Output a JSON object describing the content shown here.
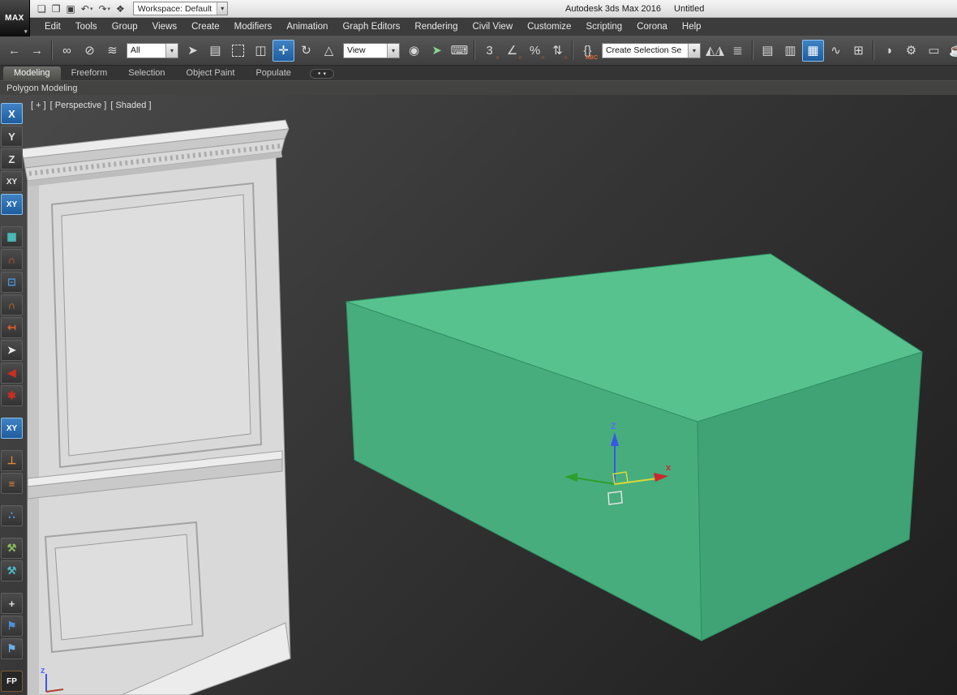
{
  "titlebar": {
    "app_button_label": "MAX",
    "quick_icons": [
      {
        "name": "new-scene-icon",
        "glyph": "❏"
      },
      {
        "name": "open-file-icon",
        "glyph": "❒"
      },
      {
        "name": "save-file-icon",
        "glyph": "▣"
      },
      {
        "name": "undo-icon",
        "glyph": "↶",
        "caret": true
      },
      {
        "name": "redo-icon",
        "glyph": "↷",
        "caret": true
      },
      {
        "name": "manage-workspace-icon",
        "glyph": "❖"
      }
    ],
    "workspace_value": "Workspace: Default",
    "window_title": "Autodesk 3ds Max 2016",
    "document_name": "Untitled"
  },
  "menubar": {
    "items": [
      "Edit",
      "Tools",
      "Group",
      "Views",
      "Create",
      "Modifiers",
      "Animation",
      "Graph Editors",
      "Rendering",
      "Civil View",
      "Customize",
      "Scripting",
      "Corona",
      "Help"
    ]
  },
  "toolbar": {
    "items": [
      {
        "name": "undo-button",
        "glyph": "←"
      },
      {
        "name": "redo-button",
        "glyph": "→"
      },
      {
        "name": "toolbar-separator",
        "sep": true
      },
      {
        "name": "select-and-link-button",
        "glyph": "∞"
      },
      {
        "name": "unlink-selection-button",
        "glyph": "⊘"
      },
      {
        "name": "bind-to-spacewarp-button",
        "glyph": "≋"
      },
      {
        "name": "selection-filter-select",
        "value": "All",
        "state": "combo-sm"
      },
      {
        "name": "select-object-button",
        "glyph": "➤"
      },
      {
        "name": "select-by-name-button",
        "glyph": "▤"
      },
      {
        "name": "rectangular-selection-button",
        "glyph": " ",
        "state": "dashed"
      },
      {
        "name": "window-crossing-button",
        "glyph": "◫"
      },
      {
        "name": "select-and-move-button",
        "glyph": "✛",
        "state": "active"
      },
      {
        "name": "select-and-rotate-button",
        "glyph": "↻"
      },
      {
        "name": "select-and-scale-button",
        "glyph": "△"
      },
      {
        "name": "reference-coordinate-select",
        "value": "View",
        "state": "combo-md"
      },
      {
        "name": "use-pivot-center-button",
        "glyph": "◉"
      },
      {
        "name": "select-and-manipulate-button",
        "glyph": "➤",
        "color": "#8fd18f"
      },
      {
        "name": "keyboard-override-button",
        "glyph": "⌨"
      },
      {
        "name": "toolbar-separator",
        "sep": true
      },
      {
        "name": "snaps-toggle-button",
        "glyph": "3",
        "sub": "∩"
      },
      {
        "name": "angle-snap-button",
        "glyph": "∠",
        "sub": "∩"
      },
      {
        "name": "percent-snap-button",
        "glyph": "%",
        "sub": "∩"
      },
      {
        "name": "spinner-snap-button",
        "glyph": "⇅",
        "sub": "∩"
      },
      {
        "name": "toolbar-separator",
        "sep": true
      },
      {
        "name": "edit-named-selections-button",
        "glyph": "{}",
        "sub": "ABC"
      },
      {
        "name": "named-selection-set-select",
        "value": "Create Selection Se",
        "state": "combo-lg"
      },
      {
        "name": "mirror-button",
        "glyph": "◭◮"
      },
      {
        "name": "align-button",
        "glyph": "≣"
      },
      {
        "name": "toolbar-separator",
        "sep": true
      },
      {
        "name": "toggle-scene-explorer-button",
        "glyph": "▤"
      },
      {
        "name": "toggle-layer-explorer-button",
        "glyph": "▥"
      },
      {
        "name": "toggle-ribbon-button",
        "glyph": "▦",
        "state": "active"
      },
      {
        "name": "curve-editor-button",
        "glyph": "∿"
      },
      {
        "name": "schematic-view-button",
        "glyph": "⊞"
      },
      {
        "name": "toolbar-separator",
        "sep": true
      },
      {
        "name": "material-editor-button",
        "glyph": "◑"
      },
      {
        "name": "render-setup-button",
        "glyph": "⚙"
      },
      {
        "name": "rendered-frame-button",
        "glyph": "▭"
      },
      {
        "name": "render-production-button",
        "glyph": "☕",
        "color": "#58b8d8"
      }
    ]
  },
  "ribbon": {
    "tabs": [
      {
        "name": "tab-modeling",
        "label": "Modeling",
        "state": "active"
      },
      {
        "name": "tab-freeform",
        "label": "Freeform"
      },
      {
        "name": "tab-selection",
        "label": "Selection"
      },
      {
        "name": "tab-object-paint",
        "label": "Object Paint"
      },
      {
        "name": "tab-populate",
        "label": "Populate"
      }
    ],
    "panel_label": "Polygon Modeling"
  },
  "viewport": {
    "labels": [
      {
        "name": "viewport-general-menu",
        "text": "[ + ]"
      },
      {
        "name": "viewport-pov-menu",
        "text": "[ Perspective ]"
      },
      {
        "name": "viewport-shading-menu",
        "text": "[ Shaded ]"
      }
    ]
  },
  "left_toolbar": {
    "items": [
      {
        "name": "constraint-x-button",
        "label": "X",
        "state": "active"
      },
      {
        "name": "constraint-y-button",
        "label": "Y"
      },
      {
        "name": "constraint-z-button",
        "label": "Z"
      },
      {
        "name": "constraint-xy-button",
        "label": "XY",
        "state": "small"
      },
      {
        "name": "constraint-xy-active-button",
        "label": "XY",
        "state": "active small"
      },
      {
        "name": "snaps-grid-button",
        "label": "▦",
        "color": "#49c6c6",
        "state": "gap"
      },
      {
        "name": "snap-angle-button",
        "label": "∩",
        "color": "#e05a2a"
      },
      {
        "name": "snap-vertex-button",
        "label": "⊡",
        "color": "#4a8fd4"
      },
      {
        "name": "snap-edge-button",
        "label": "∩",
        "color": "#e07a2a"
      },
      {
        "name": "snap-endpoint-button",
        "label": "↤",
        "color": "#e05a2a"
      },
      {
        "name": "snap-cursor-button",
        "label": "➤",
        "color": "#e8e8e8"
      },
      {
        "name": "snap-marker-button",
        "label": "◀",
        "color": "#cc2e1e"
      },
      {
        "name": "snap-pivot-button",
        "label": "✱",
        "color": "#cc2e1e"
      },
      {
        "name": "plane-xy-button",
        "label": "XY",
        "state": "active small gap"
      },
      {
        "name": "axis-constraint-button",
        "label": "⊥",
        "color": "#e08a30",
        "state": "gap"
      },
      {
        "name": "grid-tools-button",
        "label": "≡",
        "color": "#e08a30"
      },
      {
        "name": "dot-pattern-button",
        "label": "∴",
        "color": "#5a9ae0",
        "state": "gap"
      },
      {
        "name": "tool-wrench-green-button",
        "label": "⚒",
        "color": "#8ac060",
        "state": "gap"
      },
      {
        "name": "tool-wrench-teal-button",
        "label": "⚒",
        "color": "#50b8c8"
      },
      {
        "name": "add-button",
        "label": "+",
        "color": "#e0e0e0",
        "state": "gap"
      },
      {
        "name": "flag-blue-button",
        "label": "⚑",
        "color": "#4a90d9"
      },
      {
        "name": "flag-light-button",
        "label": "⚑",
        "color": "#6ab0e9"
      },
      {
        "name": "fp-button",
        "label": "FP",
        "state": "gap fp"
      }
    ]
  },
  "scene": {
    "wall": {
      "face": "#d9d9d9",
      "light": "#ececec",
      "mid": "#c9c9c9",
      "panel_inner": "#dedede"
    },
    "box": {
      "top": "#58c28e",
      "front": "#47ad7d",
      "right": "#3fa375"
    },
    "gizmo": {
      "x_label": "x",
      "z_label": "Z",
      "x_color": "#cc2a2a",
      "y_color": "#2ca02c",
      "z_color": "#3a56e8",
      "active_axis_color": "#d8d838"
    },
    "world_axis_label": "z"
  },
  "colors": {
    "active_button": "#2a6dad",
    "toolbar_bg": "#474747",
    "viewport_top": "#4a4a4a",
    "viewport_bottom": "#1e1e1e",
    "selection_green": "#58c28e"
  }
}
